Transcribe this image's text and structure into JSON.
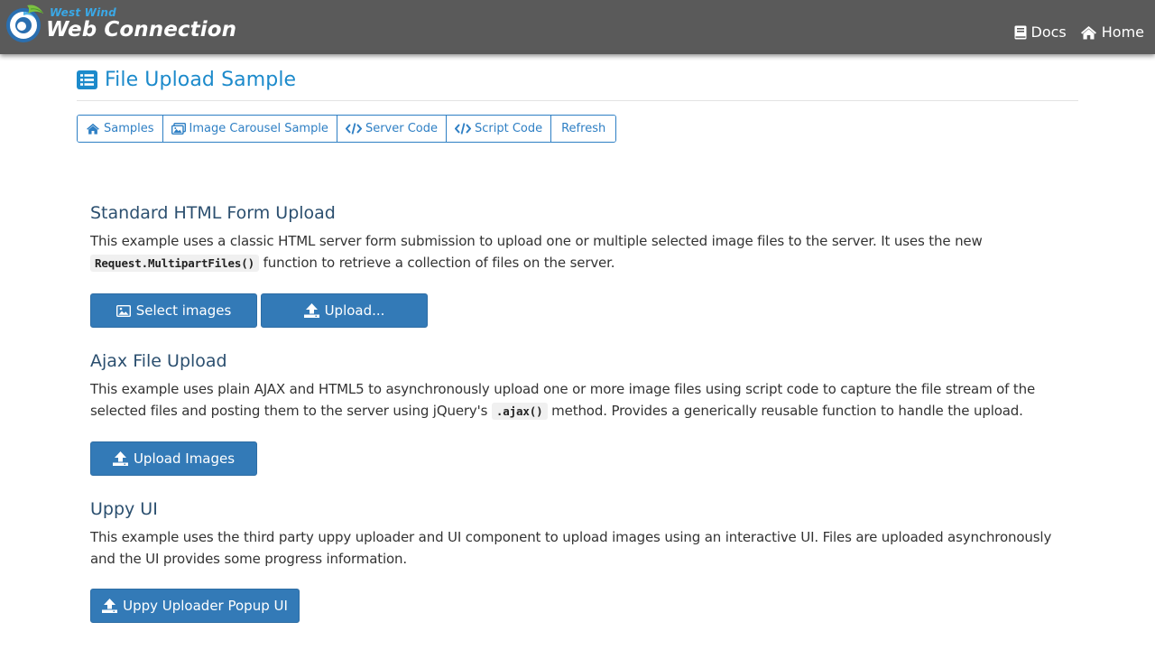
{
  "navbar": {
    "brand_small": "West Wind",
    "brand_big": "Web Connection",
    "links": [
      {
        "label": "Docs",
        "icon": "book-icon"
      },
      {
        "label": "Home",
        "icon": "home-icon"
      }
    ]
  },
  "page": {
    "title": "File Upload Sample",
    "title_icon": "list-icon"
  },
  "toolbar": {
    "buttons": [
      {
        "label": "Samples",
        "icon": "home-icon"
      },
      {
        "label": "Image Carousel Sample",
        "icon": "images-icon"
      },
      {
        "label": "Server Code",
        "icon": "code-icon"
      },
      {
        "label": "Script Code",
        "icon": "code-icon"
      },
      {
        "label": "Refresh",
        "icon": ""
      }
    ]
  },
  "sections": [
    {
      "title": "Standard HTML Form Upload",
      "text_before": "This example uses a classic HTML server form submission to upload one or multiple selected image files to the server. It uses the new ",
      "code": "Request.MultipartFiles()",
      "text_after": " function to retrieve a collection of files on the server.",
      "buttons": [
        {
          "label": "Select images",
          "icon": "image-icon"
        },
        {
          "label": "Upload...",
          "icon": "upload-icon"
        }
      ]
    },
    {
      "title": "Ajax File Upload",
      "text_before": "This example uses plain AJAX and HTML5 to asynchronously upload one or more image files using script code to capture the file stream of the selected files and posting them to the server using jQuery's ",
      "code": ".ajax()",
      "text_after": " method. Provides a generically reusable function to handle the upload.",
      "buttons": [
        {
          "label": "Upload Images",
          "icon": "upload-icon"
        }
      ]
    },
    {
      "title": "Uppy UI",
      "text_before": "This example uses the third party uppy uploader and UI component to upload images using an interactive UI. Files are uploaded asynchronously and the UI provides some progress information.",
      "code": "",
      "text_after": "",
      "buttons": [
        {
          "label": "Uppy Uploader Popup UI",
          "icon": "upload-icon"
        }
      ]
    }
  ],
  "colors": {
    "navbar": "#5a5a5a",
    "accent": "#1c8acb",
    "button": "#337ab7",
    "heading": "#2b4f6f"
  }
}
